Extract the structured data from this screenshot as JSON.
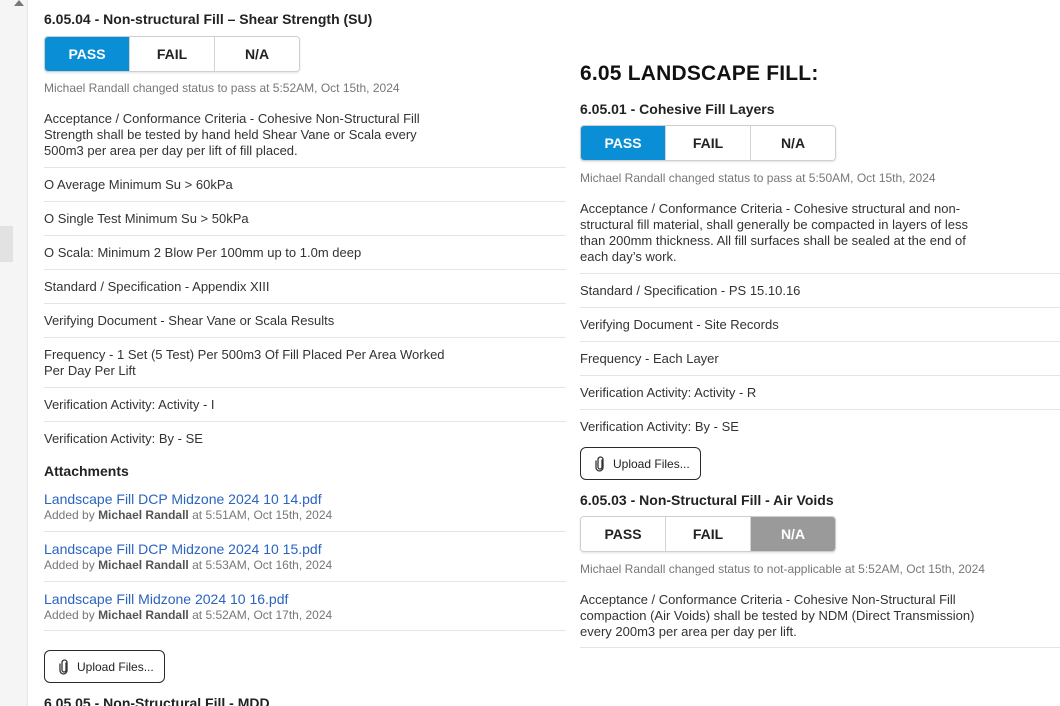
{
  "left": {
    "item_6_05_04": {
      "title": "6.05.04 - Non-structural Fill – Shear Strength (SU)",
      "buttons": {
        "pass": "PASS",
        "fail": "FAIL",
        "na": "N/A"
      },
      "selected": "PASS",
      "status": "Michael Randall changed status to pass at 5:52AM, Oct 15th, 2024",
      "criteria": "Acceptance / Conformance Criteria - Cohesive Non-Structural Fill Strength shall be tested by hand held Shear Vane or Scala every 500m3 per area per day per lift of fill placed.",
      "rows": [
        "O Average Minimum Su > 60kPa",
        "O Single Test Minimum Su > 50kPa",
        "O Scala: Minimum 2 Blow Per 100mm up to 1.0m deep",
        "Standard / Specification - Appendix XIII",
        "Verifying Document - Shear Vane or Scala Results",
        "Frequency - 1 Set (5 Test) Per 500m3 Of Fill Placed Per Area Worked Per Day Per Lift",
        "Verification Activity: Activity - I",
        "Verification Activity: By - SE"
      ],
      "attachments_heading": "Attachments",
      "attachments": [
        {
          "name": "Landscape Fill DCP Midzone 2024 10 14.pdf",
          "added_by_prefix": "Added by",
          "user": "Michael Randall",
          "when": "at 5:51AM, Oct 15th, 2024"
        },
        {
          "name": "Landscape Fill DCP Midzone 2024 10 15.pdf",
          "added_by_prefix": "Added by",
          "user": "Michael Randall",
          "when": "at 5:53AM, Oct 16th, 2024"
        },
        {
          "name": "Landscape Fill Midzone 2024 10 16.pdf",
          "added_by_prefix": "Added by",
          "user": "Michael Randall",
          "when": "at 5:52AM, Oct 17th, 2024"
        }
      ],
      "upload_label": "Upload Files..."
    },
    "next_item_title": "6.05.05 - Non-Structural Fill - MDD"
  },
  "right": {
    "section_title": "6.05 LANDSCAPE FILL:",
    "item_6_05_01": {
      "title": "6.05.01 - Cohesive Fill Layers",
      "buttons": {
        "pass": "PASS",
        "fail": "FAIL",
        "na": "N/A"
      },
      "selected": "PASS",
      "status": "Michael Randall changed status to pass at 5:50AM, Oct 15th, 2024",
      "criteria": "Acceptance / Conformance Criteria - Cohesive structural and non-structural fill material, shall generally be compacted in layers of less than 200mm thickness. All fill surfaces shall be sealed at the end of each day’s work.",
      "rows": [
        "Standard / Specification - PS 15.10.16",
        "Verifying Document - Site Records",
        "Frequency - Each Layer",
        "Verification Activity: Activity - R",
        "Verification Activity: By - SE"
      ],
      "upload_label": "Upload Files..."
    },
    "item_6_05_03": {
      "title": "6.05.03 - Non-Structural Fill - Air Voids",
      "buttons": {
        "pass": "PASS",
        "fail": "FAIL",
        "na": "N/A"
      },
      "selected": "N/A",
      "status": "Michael Randall changed status to not-applicable at 5:52AM, Oct 15th, 2024",
      "criteria": "Acceptance / Conformance Criteria - Cohesive Non-Structural Fill compaction (Air Voids) shall be tested by NDM (Direct Transmission) every 200m3 per area per day per lift."
    }
  },
  "colors": {
    "pass_selected": "#0a8fd6",
    "na_selected": "#9a9a9a",
    "link": "#2a63c0"
  },
  "icons": {
    "upload": "paperclip-icon",
    "scroll": "scroll-up-arrow-icon"
  }
}
